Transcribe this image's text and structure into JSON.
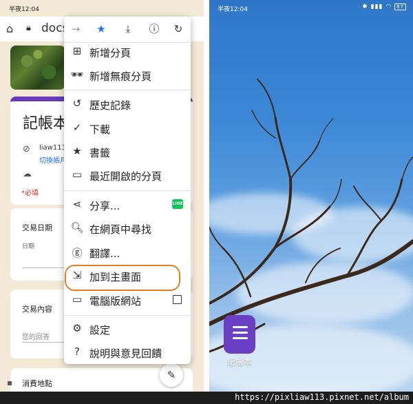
{
  "left_phone": {
    "status": {
      "time": "半夜12:04",
      "battery": "87"
    },
    "address_bar": {
      "url": "docs"
    },
    "form": {
      "title": "記帳本",
      "user": "liaw113",
      "switch_account": "切換帳戶",
      "required": "*必填",
      "question_date": "交易日期",
      "date_sub": "日期",
      "question_content": "交易內容",
      "content_placeholder": "您的回答",
      "question_place": "消費地點"
    },
    "menu": {
      "items": [
        {
          "label": "新增分頁",
          "icon": "new-tab-icon"
        },
        {
          "label": "新增無痕分頁",
          "icon": "incognito-icon"
        },
        {
          "label": "歷史記錄",
          "icon": "history-icon"
        },
        {
          "label": "下載",
          "icon": "downloads-icon"
        },
        {
          "label": "書籤",
          "icon": "bookmarks-icon"
        },
        {
          "label": "最近開啟的分頁",
          "icon": "recent-tabs-icon"
        },
        {
          "label": "分享...",
          "icon": "share-icon"
        },
        {
          "label": "在網頁中尋找",
          "icon": "find-in-page-icon"
        },
        {
          "label": "翻譯...",
          "icon": "translate-icon"
        },
        {
          "label": "加到主畫面",
          "icon": "add-to-home-icon"
        },
        {
          "label": "電腦版網站",
          "icon": "desktop-site-icon"
        },
        {
          "label": "設定",
          "icon": "settings-icon"
        },
        {
          "label": "說明與意見回饋",
          "icon": "help-icon"
        }
      ],
      "line_badge": "LINE"
    }
  },
  "right_phone": {
    "status": {
      "time": "半夜12:04",
      "battery": "87"
    },
    "app_label": "記帳本"
  },
  "watermark": "https://pixliaw113.pixnet.net/album",
  "colors": {
    "accent": "#673ab7",
    "highlight": "#e67e22",
    "star": "#1a73e8"
  }
}
